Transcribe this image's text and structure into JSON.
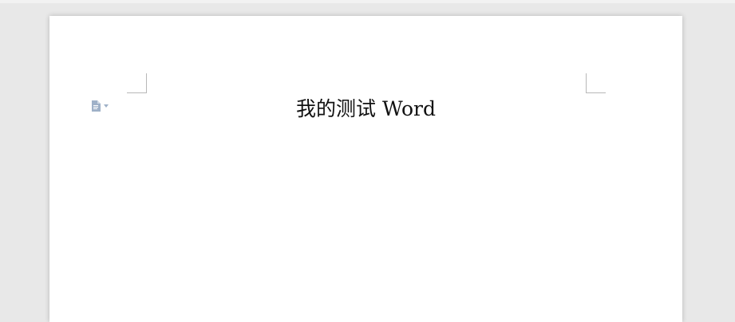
{
  "document": {
    "title": "我的测试 Word"
  },
  "icons": {
    "paragraph_handle": "document-icon",
    "dropdown": "caret-down-icon"
  },
  "colors": {
    "workspace": "#e8e8e8",
    "page": "#ffffff",
    "text": "#111111",
    "margin_marks": "#b8b8b8",
    "handle": "#9fb1c8"
  }
}
